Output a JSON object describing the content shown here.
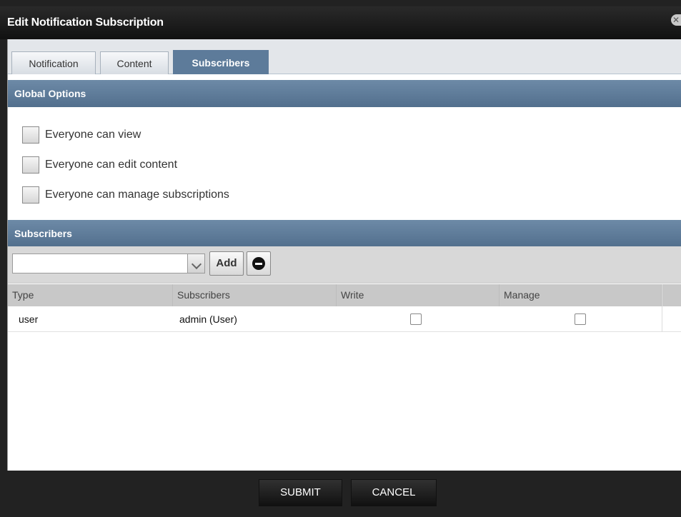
{
  "dialog": {
    "title": "Edit Notification Subscription",
    "close_icon": "close-icon"
  },
  "tabs": [
    {
      "label": "Notification",
      "active": false
    },
    {
      "label": "Content",
      "active": false
    },
    {
      "label": "Subscribers",
      "active": true
    }
  ],
  "global_options": {
    "header": "Global Options",
    "options": [
      {
        "label": "Everyone can view",
        "checked": false
      },
      {
        "label": "Everyone can edit content",
        "checked": false
      },
      {
        "label": "Everyone can manage subscriptions",
        "checked": false
      }
    ]
  },
  "subscribers": {
    "header": "Subscribers",
    "add_label": "Add",
    "remove_icon": "remove-icon",
    "dropdown_icon": "chevron-down-icon",
    "input_value": "",
    "columns": [
      "Type",
      "Subscribers",
      "Write",
      "Manage"
    ],
    "rows": [
      {
        "type": "user",
        "subscriber": "admin (User)",
        "write": false,
        "manage": false
      }
    ]
  },
  "footer": {
    "submit_label": "SUBMIT",
    "cancel_label": "CANCEL"
  },
  "colors": {
    "section_header": "#5d7b9a",
    "dialog_background": "#222222"
  }
}
